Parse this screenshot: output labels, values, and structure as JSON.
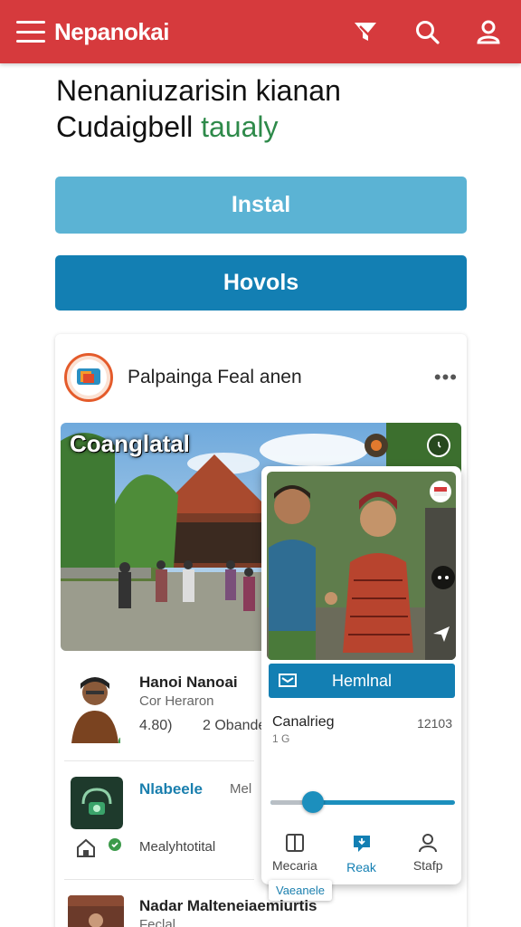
{
  "app": {
    "title": "Nepanokai"
  },
  "header": {
    "line1": "Nenaniuzarisin kianan",
    "line2_main": "Cudaigbell",
    "line2_accent": "taualy"
  },
  "buttons": {
    "install": "Instal",
    "hovols": "Hovols"
  },
  "feed_card": {
    "title": "Palpainga Feal anen",
    "hero_caption": "Coanglatal"
  },
  "list": [
    {
      "name": "Hanoi Nanoai",
      "sub": "Cor Heraron",
      "stat1": "4.80)",
      "stat2": "2 Obande"
    },
    {
      "name": "Nlabeele",
      "tag": "Mel",
      "action": "Mealyhtotital"
    }
  ],
  "popup": {
    "button_label": "Hemlnal",
    "label": "Canalrieg",
    "sub": "1 G",
    "value": "12103",
    "slider_value": 0.23,
    "nav": [
      {
        "label": "Mecaria",
        "icon": "book-icon"
      },
      {
        "label": "Reak",
        "icon": "chat-pin-icon"
      },
      {
        "label": "Stafp",
        "icon": "person-icon"
      }
    ]
  },
  "tooltip": "Vaeanele",
  "bottom_row": {
    "name": "Nadar Malteneiaemiurtis",
    "sub": "Feclal"
  },
  "colors": {
    "topbar": "#d63a3d",
    "install": "#5bb3d4",
    "primary": "#137fb3",
    "accent_green": "#2e8a4a"
  }
}
